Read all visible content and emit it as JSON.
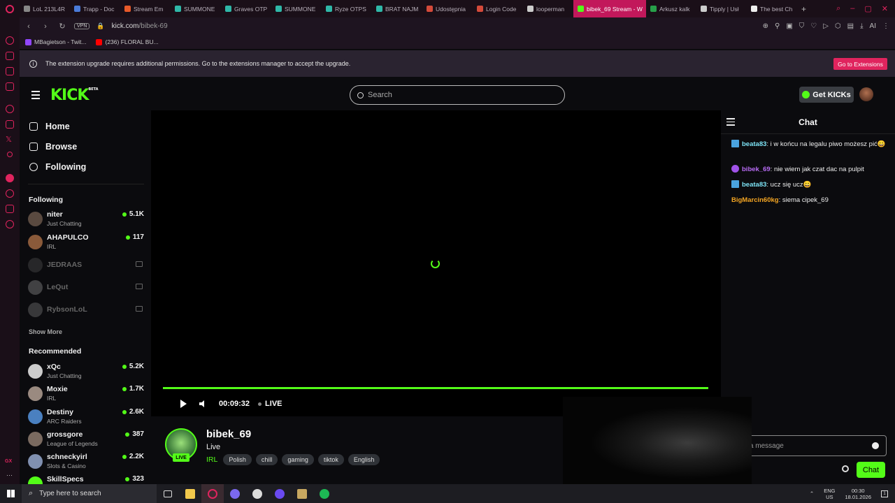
{
  "browser": {
    "tabs": [
      {
        "label": "LoL 213L4R",
        "color": "#888888"
      },
      {
        "label": "Trapp - Doc",
        "color": "#4a7bd8"
      },
      {
        "label": "Stream Em",
        "color": "#e85a2a"
      },
      {
        "label": "SUMMONE",
        "color": "#2fb8a8"
      },
      {
        "label": "Graves OTP",
        "color": "#2fb8a8"
      },
      {
        "label": "SUMMONE",
        "color": "#2fb8a8"
      },
      {
        "label": "Ryze OTPS",
        "color": "#2fb8a8"
      },
      {
        "label": "BRAT NAJM",
        "color": "#2fb8a8"
      },
      {
        "label": "Udostępnia",
        "color": "#d44a3a"
      },
      {
        "label": "Login Code",
        "color": "#d44a3a"
      },
      {
        "label": "looperman",
        "color": "#cccccc"
      },
      {
        "label": "bibek_69 Stream - W",
        "color": "#53fc18",
        "active": true
      },
      {
        "label": "Arkusz kalk",
        "color": "#27a049"
      },
      {
        "label": "Tipply | Usł",
        "color": "#cccccc"
      },
      {
        "label": "The best Ch",
        "color": "#eeeeee"
      }
    ],
    "new_tab": "+",
    "vpn_label": "VPN",
    "url_host": "kick.com",
    "url_path": "/bibek-69",
    "ai_label": "AI",
    "bookmarks": [
      {
        "label": "MBagietson - Twit...",
        "color": "#9146ff"
      },
      {
        "label": "(236) FLORAL BU...",
        "color": "#ff0000"
      }
    ],
    "notice_text": "The extension upgrade requires additional permissions. Go to the extensions manager to accept the upgrade.",
    "notice_button": "Go to Extensions"
  },
  "kick": {
    "logo_text": "KICK",
    "logo_badge": "BETA",
    "search_placeholder": "Search",
    "get_kicks": "Get KICKs",
    "nav": [
      {
        "label": "Home",
        "icon": "home-icon"
      },
      {
        "label": "Browse",
        "icon": "browse-icon"
      },
      {
        "label": "Following",
        "icon": "heart-icon"
      }
    ],
    "following_title": "Following",
    "following": [
      {
        "name": "niter",
        "category": "Just Chatting",
        "viewers": "5.1K",
        "live": true
      },
      {
        "name": "AHAPULCO",
        "category": "IRL",
        "viewers": "117",
        "live": true
      },
      {
        "name": "JEDRAAS",
        "live": false
      },
      {
        "name": "LeQut",
        "live": false
      },
      {
        "name": "RybsonLoL",
        "live": false
      }
    ],
    "show_more": "Show More",
    "recommended_title": "Recommended",
    "recommended": [
      {
        "name": "xQc",
        "category": "Just Chatting",
        "viewers": "5.2K"
      },
      {
        "name": "Moxie",
        "category": "IRL",
        "viewers": "1.7K"
      },
      {
        "name": "Destiny",
        "category": "ARC Raiders",
        "viewers": "2.6K"
      },
      {
        "name": "grossgore",
        "category": "League of Legends",
        "viewers": "387"
      },
      {
        "name": "schneckyirl",
        "category": "Slots & Casino",
        "viewers": "2.2K"
      },
      {
        "name": "SkillSpecs",
        "category": "",
        "viewers": "323"
      }
    ],
    "player": {
      "time": "00:09:32",
      "live_label": "LIVE",
      "progress": 1.0
    },
    "stream": {
      "name": "bibek_69",
      "title": "Live",
      "live_badge": "LIVE",
      "category": "IRL",
      "tags": [
        "Polish",
        "chill",
        "gaming",
        "tiktok",
        "English"
      ]
    },
    "chat": {
      "title": "Chat",
      "messages": [
        {
          "user": "beata83",
          "color": "#7de3f5",
          "badge": "#4aa3df",
          "text": "i w końcu na legalu piwo możesz pić😀"
        },
        {
          "user": "bibek_69",
          "color": "#b86cf5",
          "badge": "#a052e8",
          "text": "nie wiem jak czat dac na pulpit"
        },
        {
          "user": "beata83",
          "color": "#7de3f5",
          "badge": "#4aa3df",
          "text": "ucz się ucz😀"
        },
        {
          "user": "BigMarcin60kg",
          "color": "#f5a623",
          "text": "siema cipek_69"
        }
      ],
      "input_placeholder": "nd a message",
      "send_label": "Chat"
    }
  },
  "taskbar": {
    "search_placeholder": "Type here to search",
    "lang_top": "ENG",
    "lang_bottom": "US",
    "time": "00:30",
    "date": "18.01.2026",
    "notif_count": "1"
  }
}
